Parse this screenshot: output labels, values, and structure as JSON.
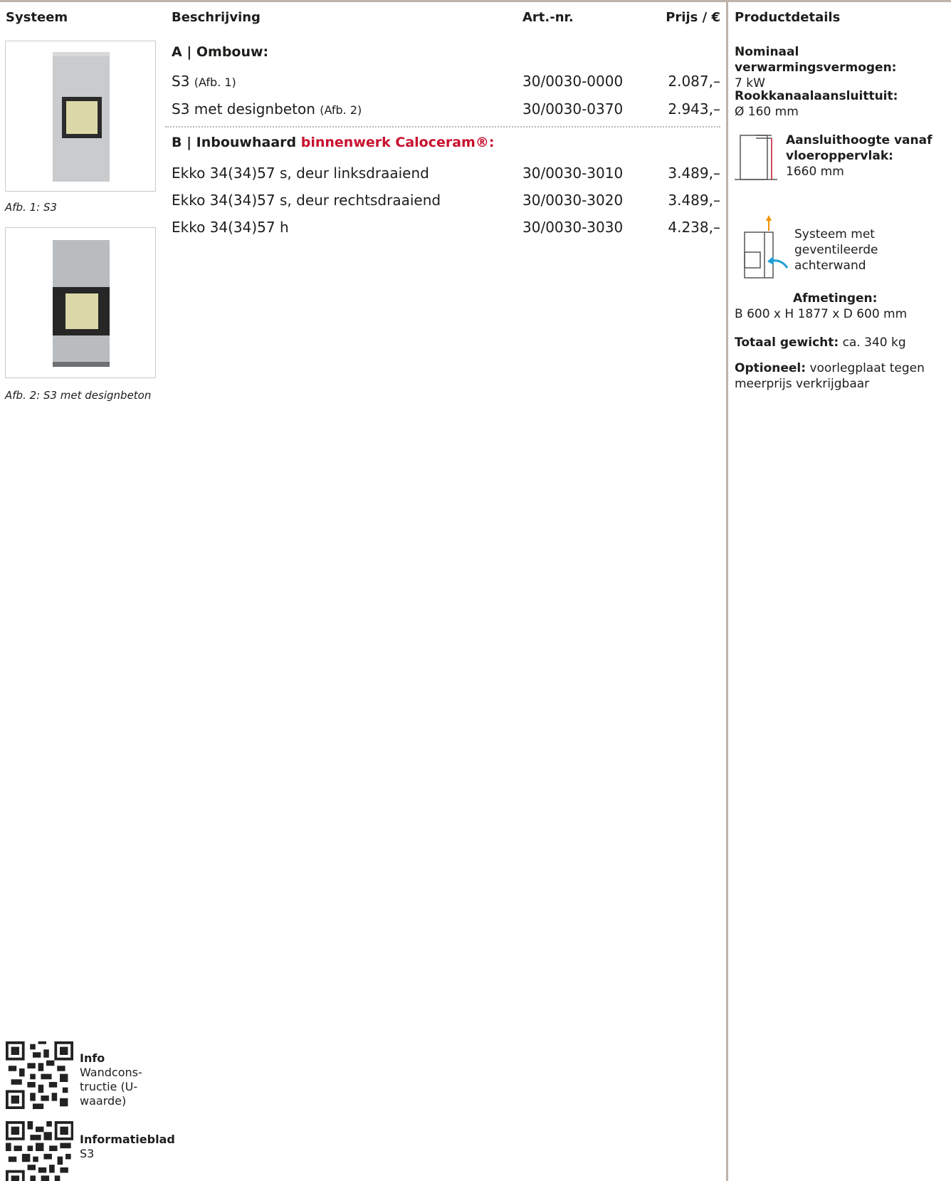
{
  "header": {
    "col_systeem": "Systeem",
    "col_beschrijving": "Beschrijving",
    "col_artnr": "Art.-nr.",
    "col_prijs": "Prijs / €",
    "col_details": "Productdetails"
  },
  "section_a": {
    "title": "A | Ombouw:",
    "rows": [
      {
        "name": "S3",
        "note": "(Afb. 1)",
        "art": "30/0030-0000",
        "price": "2.087,–"
      },
      {
        "name": "S3 met designbeton",
        "note": "(Afb. 2)",
        "art": "30/0030-0370",
        "price": "2.943,–"
      }
    ]
  },
  "section_b": {
    "title_prefix": "B | Inbouwhaard",
    "title_highlight": "binnenwerk Caloceram®:",
    "rows": [
      {
        "name": "Ekko 34(34)57 s, deur linksdraaiend",
        "art": "30/0030-3010",
        "price": "3.489,–"
      },
      {
        "name": "Ekko 34(34)57 s, deur rechtsdraaiend",
        "art": "30/0030-3020",
        "price": "3.489,–"
      },
      {
        "name": "Ekko 34(34)57 h",
        "art": "30/0030-3030",
        "price": "4.238,–"
      }
    ]
  },
  "captions": {
    "fig1": "Afb. 1: S3",
    "fig2": "Afb. 2: S3 met designbeton"
  },
  "details": {
    "power_label": "Nominaal verwarmingsvermogen:",
    "power_value": "7 kW",
    "flue_label": "Rookkanaalaansluittuit:",
    "flue_value": "Ø 160 mm",
    "height_label": "Aansluithoogte vanaf vloeroppervlak:",
    "height_value": "1660 mm",
    "ventilated": "Systeem met geventileerde achterwand",
    "dim_label": "Afmetingen:",
    "dim_value": "B 600 x H 1877 x D 600 mm",
    "weight_label": "Totaal gewicht:",
    "weight_value": "ca. 340 kg",
    "optional_label": "Optioneel:",
    "optional_value": "voorlegplaat tegen meerprijs verkrijgbaar"
  },
  "qr": {
    "info_title": "Info",
    "info_text": "Wandcons- tructie (U-waarde)",
    "sheet_title": "Informatieblad",
    "sheet_text": "S3"
  },
  "colors": {
    "rule": "#bdb3ab",
    "highlight": "#c8102e",
    "text": "#1d1d1b"
  }
}
